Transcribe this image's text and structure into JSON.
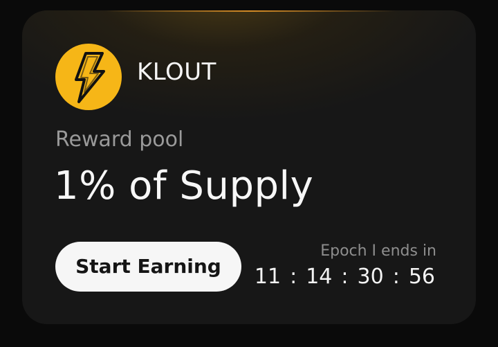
{
  "card": {
    "brand_name": "KLOUT",
    "logo_icon": "lightning-bolt-icon",
    "pool_label": "Reward pool",
    "pool_value": "1% of Supply",
    "cta_label": "Start Earning",
    "epoch_label": "Epoch I ends in",
    "countdown": {
      "hours": "11",
      "minutes": "14",
      "seconds": "30",
      "centiseconds": "56",
      "separator": ":"
    }
  },
  "colors": {
    "accent": "#f6b617",
    "card_background": "#171717",
    "page_background": "#0a0a0a",
    "button_background": "#f6f6f6",
    "muted_text": "#9a9a9a"
  }
}
